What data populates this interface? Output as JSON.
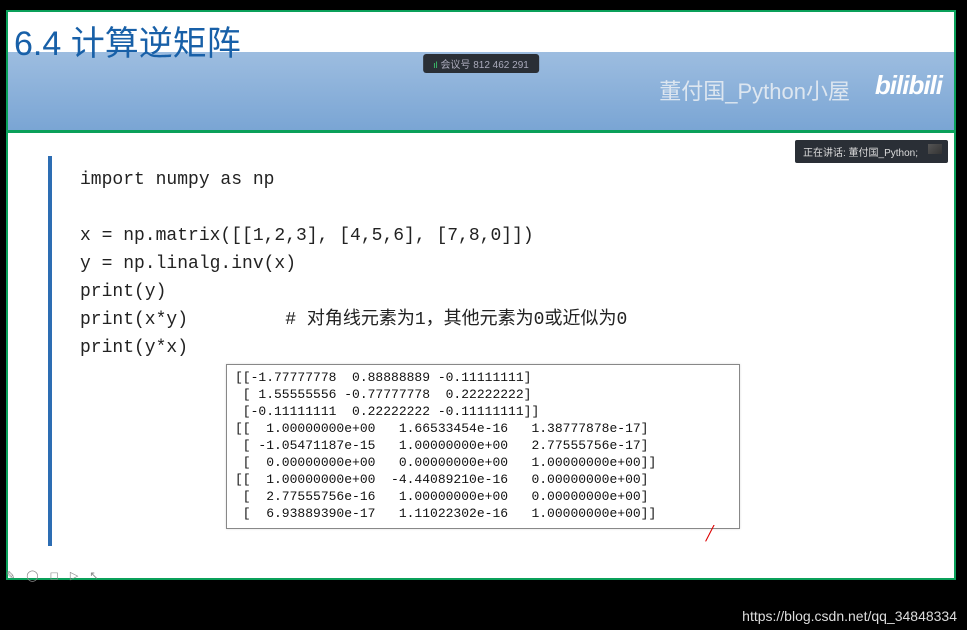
{
  "header": {
    "title": "6.4  计算逆矩阵",
    "watermark": "董付国_Python小屋",
    "bili": "bilibili"
  },
  "badges": {
    "meeting_prefix": "会议号",
    "meeting_id": "812 462 291",
    "speaker_prefix": "正在讲话:",
    "speaker_name": "董付国_Python;"
  },
  "code": {
    "line1": "import numpy as np",
    "line2": "",
    "line3": "x = np.matrix([[1,2,3], [4,5,6], [7,8,0]])",
    "line4": "y = np.linalg.inv(x)",
    "line5": "print(y)",
    "line6": "print(x*y)         # 对角线元素为1，其他元素为0或近似为0",
    "line7": "print(y*x)"
  },
  "output": "[[-1.77777778  0.88888889 -0.11111111]\n [ 1.55555556 -0.77777778  0.22222222]\n [-0.11111111  0.22222222 -0.11111111]]\n[[  1.00000000e+00   1.66533454e-16   1.38777878e-17]\n [ -1.05471187e-15   1.00000000e+00   2.77555756e-17]\n [  0.00000000e+00   0.00000000e+00   1.00000000e+00]]\n[[  1.00000000e+00  -4.44089210e-16   0.00000000e+00]\n [  2.77555756e-16   1.00000000e+00   0.00000000e+00]\n [  6.93889390e-17   1.11022302e-16   1.00000000e+00]]",
  "footer": {
    "url": "https://blog.csdn.net/qq_34848334"
  }
}
